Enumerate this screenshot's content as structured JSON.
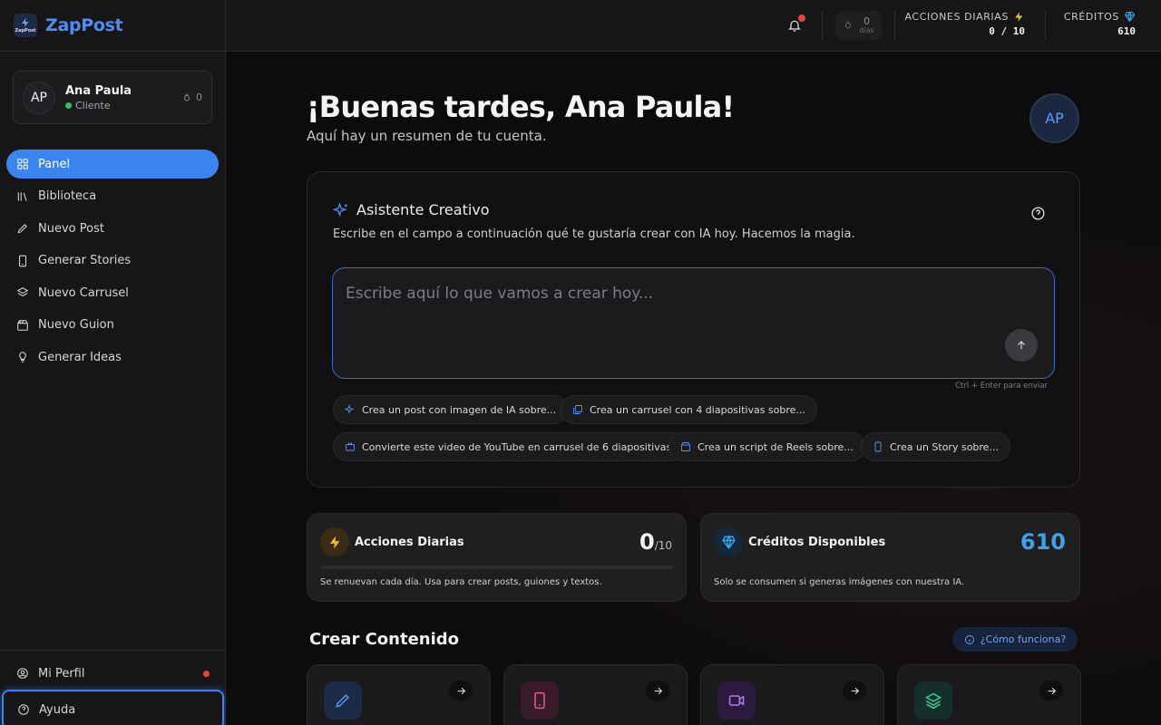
{
  "brand": {
    "logo_text": "ZapPost",
    "name": "ZapPost"
  },
  "user": {
    "initials": "AP",
    "name": "Ana Paula",
    "role": "Cliente",
    "streak": "0"
  },
  "nav": {
    "items": [
      {
        "label": "Panel",
        "icon": "grid-icon",
        "active": true
      },
      {
        "label": "Biblioteca",
        "icon": "library-icon"
      },
      {
        "label": "Nuevo Post",
        "icon": "pencil-icon"
      },
      {
        "label": "Generar Stories",
        "icon": "phone-icon"
      },
      {
        "label": "Nuevo Carrusel",
        "icon": "layers-icon"
      },
      {
        "label": "Nuevo Guion",
        "icon": "clapperboard-icon"
      },
      {
        "label": "Generar Ideas",
        "icon": "lightbulb-icon"
      }
    ],
    "bottom": [
      {
        "label": "Mi Perfil",
        "icon": "user-circle-icon"
      },
      {
        "label": "Ayuda",
        "icon": "help-circle-icon"
      }
    ]
  },
  "topbar": {
    "streak_value": "0",
    "streak_label": "días",
    "daily_actions_label": "ACCIONES DIARIAS",
    "daily_actions_value": "0 / 10",
    "credits_label": "CRÉDITOS",
    "credits_value": "610"
  },
  "main": {
    "greeting": "¡Buenas tardes, Ana Paula!",
    "subtitle": "Aquí hay un resumen de tu cuenta.",
    "avatar_initials": "AP",
    "assistant": {
      "title": "Asistente Creativo",
      "description": "Escribe en el campo a continuación qué te gustaría crear con IA hoy. Hacemos la magia.",
      "placeholder": "Escribe aquí lo que vamos a crear hoy...",
      "hint": "Ctrl + Enter para enviar",
      "chips": [
        "Crea un post con imagen de IA sobre...",
        "Crea un carrusel con 4 diapositivas sobre...",
        "Convierte este video de YouTube en carrusel de 6 diapositivas:",
        "Crea un script de Reels sobre...",
        "Crea un Story sobre..."
      ]
    },
    "stats": {
      "daily": {
        "title": "Acciones Diarias",
        "value": "0",
        "max": "/10",
        "note": "Se renuevan cada día. Usa para crear posts, guiones y textos.",
        "progress": 0
      },
      "credits": {
        "title": "Créditos Disponibles",
        "value": "610",
        "note": "Solo se consumen si generas imágenes con nuestra IA."
      }
    },
    "create": {
      "title": "Crear Contenido",
      "how_label": "¿Cómo funciona?"
    }
  },
  "colors": {
    "accent": "#3c84ef",
    "credits": "#3ba3e8",
    "lightning": "#f5b731"
  }
}
